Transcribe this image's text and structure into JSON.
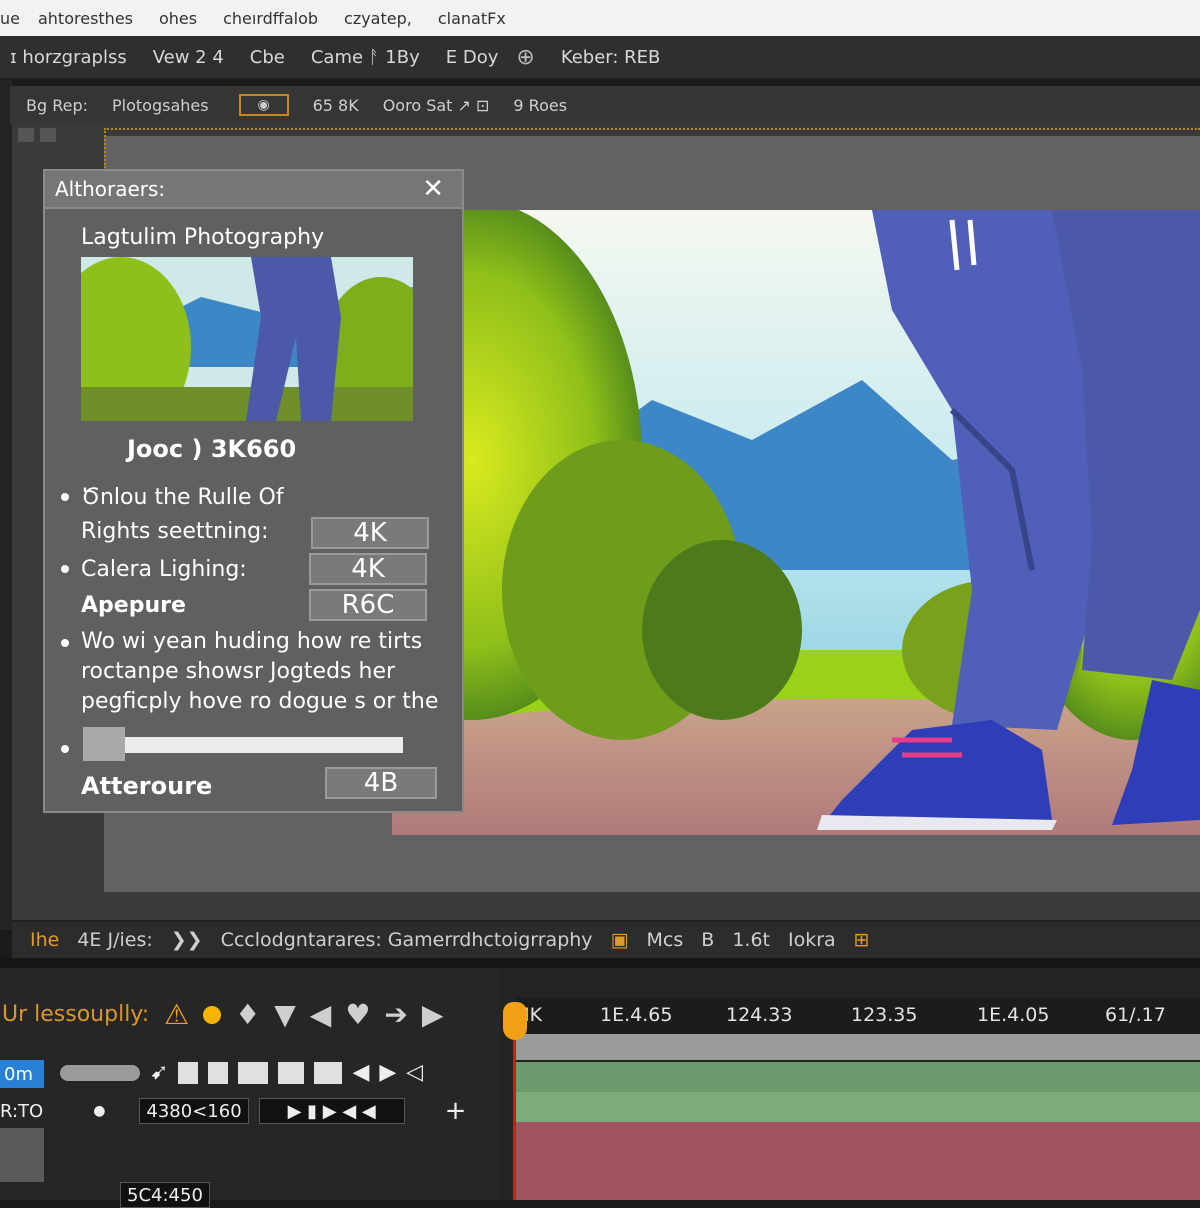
{
  "menubar": [
    "ue",
    "ahtoresthes",
    "ohes",
    "cheırdffalob",
    "czyatep,",
    "clanatFx"
  ],
  "toolbar": {
    "items": [
      "ɪ horzgraplss",
      "Vew 2  4",
      "Cbe",
      "Came ᚨ 1By",
      "E Doy"
    ],
    "globe_icon": "globe-icon",
    "color_mode": "Keber: REB"
  },
  "optionsbar": {
    "label1": "Bg Rep:",
    "label2": "Plotogsahes",
    "eye_icon": "eye-icon",
    "size": "65 8K",
    "info": "Ooro Sat ↗ ⊡",
    "rows": "9 Roes"
  },
  "panel": {
    "header": "Althoraers:",
    "close_icon": "close-icon",
    "title": "Lagtulim Photography",
    "resolution": "Jooc ) 3K660",
    "bullet1": "Ծnlou the Rulle Of",
    "setting1_label": "Rights seettning:",
    "setting1_value": "4K",
    "bullet2": "Calera Lighing:",
    "setting2_value": "4K",
    "setting3_label": "Apepure",
    "setting3_value": "R6C",
    "bullet3_lines": [
      "Wo wi yean huding how re tirts",
      "roctanpe showsr Jogteds her",
      "pegficply hove ro dogue s or the"
    ],
    "slider_value": 0.13,
    "footer_label": "Atteroure",
    "footer_value": "4B"
  },
  "pathbar": {
    "prefix": "Ihe",
    "files": "4E J/ies:",
    "path": "Ccclodgntarares: Gamerrdhctoigrraphy",
    "mode": "Mcs",
    "b_label": "B",
    "ratio": "1.6t",
    "lock": "Iokra"
  },
  "timeline": {
    "title": "Ur lessouplly:",
    "tab": "0m",
    "row_label": "R:TO",
    "timecode": "4380<160",
    "timecode2": "5C4:450",
    "ruler": [
      "IK",
      "1E.4.65",
      "124.33",
      "123.35",
      "1E.4.05",
      "61/.17"
    ]
  },
  "colors": {
    "accent": "#e09a2a",
    "playhead": "#d31a1a",
    "track_green": "#6c9a6c",
    "track_red": "#a3535d"
  }
}
